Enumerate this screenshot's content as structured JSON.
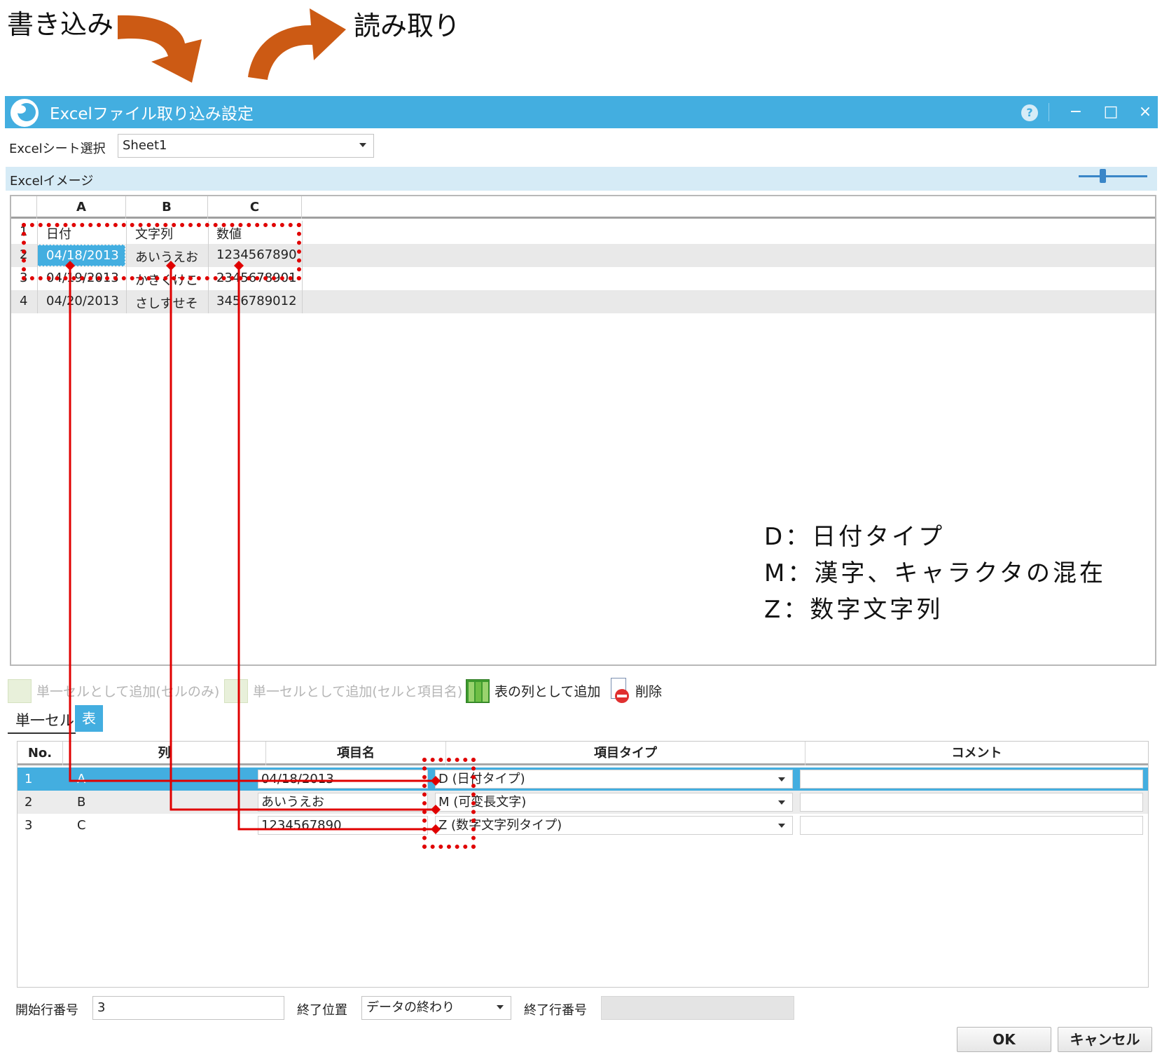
{
  "annotations": {
    "write_label": "書き込み",
    "read_label": "読み取り",
    "legend": [
      "D：日付タイプ",
      "M：漢字、キャラクタの混在",
      "Z：数字文字列"
    ]
  },
  "window": {
    "title": "Excelファイル取り込み設定",
    "help_icon": "?",
    "minimize": "−",
    "maximize": "□",
    "close": "×"
  },
  "sheet_select": {
    "label": "Excelシート選択",
    "value": "Sheet1"
  },
  "image_section": {
    "label": "Excelイメージ"
  },
  "excel_grid": {
    "columns": [
      "A",
      "B",
      "C"
    ],
    "rows": [
      {
        "num": "1",
        "cells": [
          "日付",
          "文字列",
          "数値"
        ]
      },
      {
        "num": "2",
        "cells": [
          "04/18/2013",
          "あいうえお",
          "1234567890"
        ]
      },
      {
        "num": "3",
        "cells": [
          "04/19/2013",
          "かきくけこ",
          "2345678901"
        ]
      },
      {
        "num": "4",
        "cells": [
          "04/20/2013",
          "さしすせそ",
          "3456789012"
        ]
      }
    ]
  },
  "toolbar": {
    "add_single_cell": "単一セルとして追加(セルのみ)",
    "add_single_cell_with_name": "単一セルとして追加(セルと項目名)",
    "add_as_table_column": "表の列として追加",
    "delete": "削除"
  },
  "tabs": {
    "single_cell": "単一セル",
    "table": "表"
  },
  "list": {
    "headers": [
      "No.",
      "列",
      "項目名",
      "項目タイプ",
      "コメント"
    ],
    "rows": [
      {
        "no": "1",
        "col": "A",
        "name": "04/18/2013",
        "type": "D (日付タイプ)",
        "comment": ""
      },
      {
        "no": "2",
        "col": "B",
        "name": "あいうえお",
        "type": "M (可変長文字)",
        "comment": ""
      },
      {
        "no": "3",
        "col": "C",
        "name": "1234567890",
        "type": "Z (数字文字列タイプ)",
        "comment": ""
      }
    ]
  },
  "footer": {
    "start_row_label": "開始行番号",
    "start_row_value": "3",
    "end_position_label": "終了位置",
    "end_position_value": "データの終わり",
    "end_row_label": "終了行番号",
    "end_row_value": "",
    "ok": "OK",
    "cancel": "キャンセル"
  },
  "colors": {
    "titlebar": "#43aee0",
    "selected_row": "#43aee0",
    "annotation_red": "#e00000",
    "arrow_orange": "#cc5a14"
  }
}
